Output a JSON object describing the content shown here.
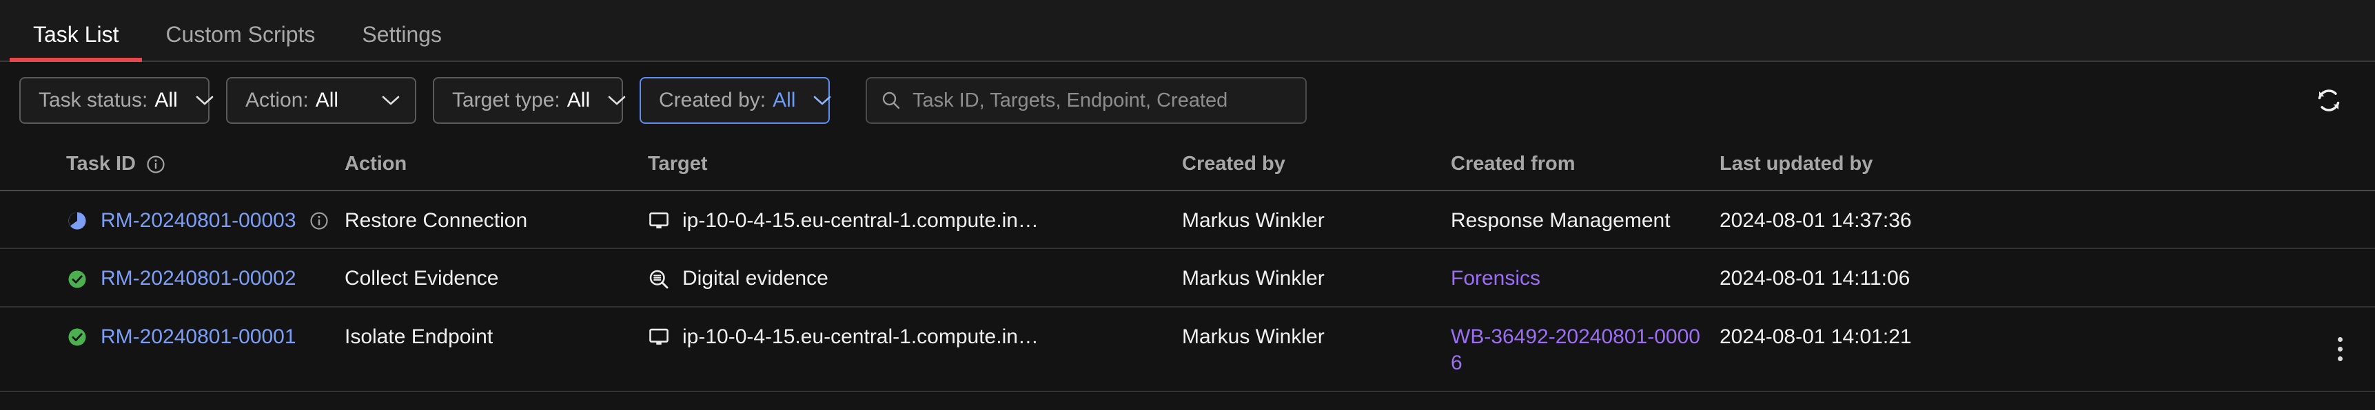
{
  "tabs": [
    {
      "label": "Task List",
      "active": true
    },
    {
      "label": "Custom Scripts",
      "active": false
    },
    {
      "label": "Settings",
      "active": false
    }
  ],
  "filters": [
    {
      "name": "task-status",
      "label": "Task status:",
      "value": "All",
      "focused": false
    },
    {
      "name": "action",
      "label": "Action:",
      "value": "All",
      "focused": false
    },
    {
      "name": "target-type",
      "label": "Target type:",
      "value": "All",
      "focused": false
    },
    {
      "name": "created-by",
      "label": "Created by:",
      "value": "All",
      "focused": true
    }
  ],
  "search": {
    "placeholder": "Task ID, Targets, Endpoint, Created",
    "value": "",
    "icon": "search-icon"
  },
  "toolbar": {
    "refresh_icon": "refresh-icon",
    "refresh_label": "Refresh"
  },
  "table": {
    "columns": [
      {
        "key": "task_id",
        "label": "Task ID",
        "info": true
      },
      {
        "key": "action",
        "label": "Action",
        "info": false
      },
      {
        "key": "target",
        "label": "Target",
        "info": false
      },
      {
        "key": "created_by",
        "label": "Created by",
        "info": false
      },
      {
        "key": "created_from",
        "label": "Created from",
        "info": false
      },
      {
        "key": "updated",
        "label": "Last updated by",
        "info": false
      }
    ],
    "rows": [
      {
        "status_icon": "pie-progress-icon",
        "task_id": "RM-20240801-00003",
        "task_id_info": true,
        "action": "Restore Connection",
        "target_icon": "monitor-icon",
        "target": "ip-10-0-4-15.eu-central-1.compute.in…",
        "created_by": "Markus Winkler",
        "created_from": "Response Management",
        "created_from_link": false,
        "updated": "2024-08-01 14:37:36",
        "kebab": false
      },
      {
        "status_icon": "check-circle-icon",
        "task_id": "RM-20240801-00002",
        "task_id_info": false,
        "action": "Collect Evidence",
        "target_icon": "evidence-search-icon",
        "target": "Digital evidence",
        "created_by": "Markus Winkler",
        "created_from": "Forensics",
        "created_from_link": true,
        "updated": "2024-08-01 14:11:06",
        "kebab": false
      },
      {
        "status_icon": "check-circle-icon",
        "task_id": "RM-20240801-00001",
        "task_id_info": false,
        "action": "Isolate Endpoint",
        "target_icon": "monitor-icon",
        "target": "ip-10-0-4-15.eu-central-1.compute.in…",
        "created_by": "Markus Winkler",
        "created_from": "WB-36492-20240801-00006",
        "created_from_link": true,
        "updated": "2024-08-01 14:01:21",
        "kebab": true
      }
    ]
  },
  "colors": {
    "accent_red": "#e8474c",
    "link_blue": "#7c9ff5",
    "link_purple": "#9b6ef3",
    "focus_blue": "#5d8df5",
    "success_green": "#4caf50",
    "background": "#141414"
  }
}
